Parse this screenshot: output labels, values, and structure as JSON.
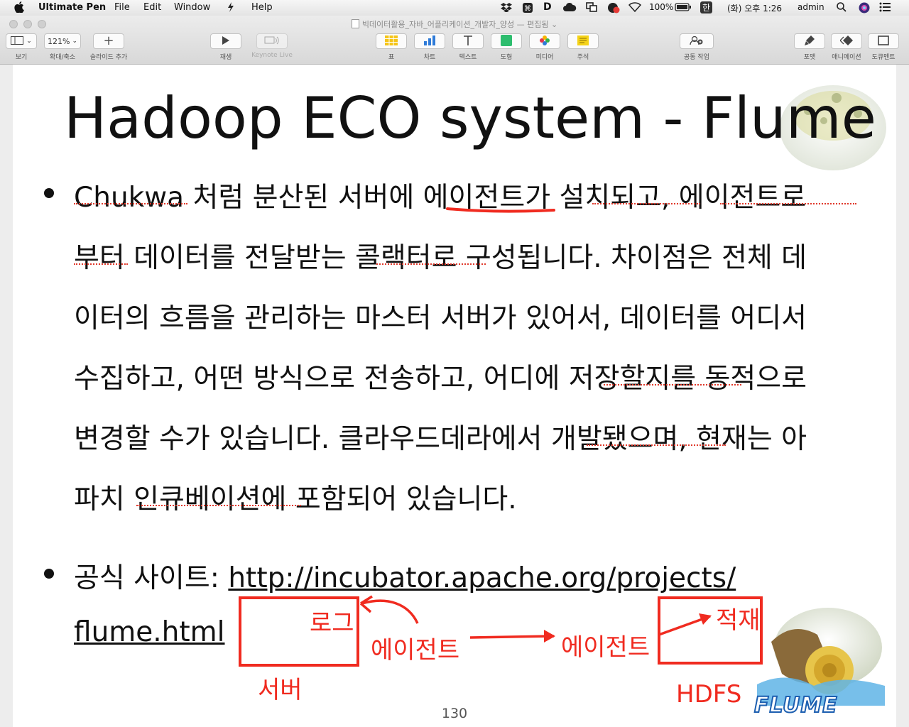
{
  "menubar": {
    "apple": "",
    "app_name": "Ultimate Pen",
    "menus": [
      "File",
      "Edit",
      "Window",
      "Help"
    ],
    "battery": "100%",
    "input_method": "한",
    "clock": "(화) 오후 1:26",
    "user": "admin"
  },
  "window": {
    "title": "빅데이터활용_자바_어플리케이션_개발자_양성 — 편집됨"
  },
  "toolbar": {
    "view_label": "보기",
    "zoom_value": "121%",
    "zoom_label": "확대/축소",
    "add_slide_label": "슬라이드 추가",
    "play_label": "재생",
    "keynote_live_label": "Keynote Live",
    "table_label": "표",
    "chart_label": "차트",
    "text_label": "텍스트",
    "shape_label": "도형",
    "media_label": "미디어",
    "comment_label": "주석",
    "collaborate_label": "공동 작업",
    "format_label": "포맷",
    "animate_label": "애니메이션",
    "document_label": "도큐멘트"
  },
  "slide": {
    "title": "Hadoop ECO system - Flume",
    "bullet1_lines": [
      "Chukwa 처럼 분산된 서버에 에이전트가 설치되고, 에이전트로",
      "부터 데이터를 전달받는 콜랙터로 구성됩니다. 차이점은 전체 데",
      "이터의 흐름을 관리하는 마스터 서버가 있어서, 데이터를 어디서",
      "수집하고, 어떤 방식으로 전송하고, 어디에 저장할지를 동적으로",
      "변경할 수가 있습니다. 클라우드데라에서 개발됐으며, 현재는 아",
      "파치 인큐베이션에 포함되어 있습니다."
    ],
    "bullet2_prefix": "공식 사이트: ",
    "bullet2_link_part1": "http://incubator.apache.org/projects/",
    "bullet2_link_part2": "flume.html",
    "page_number": "130",
    "logo_text": "FLUME"
  },
  "annotations": {
    "log": "로그",
    "agent_1": "에이전트",
    "agent_2": "에이전트",
    "load": "적재",
    "server": "서버",
    "hdfs": "HDFS",
    "color": "#f02b20"
  }
}
